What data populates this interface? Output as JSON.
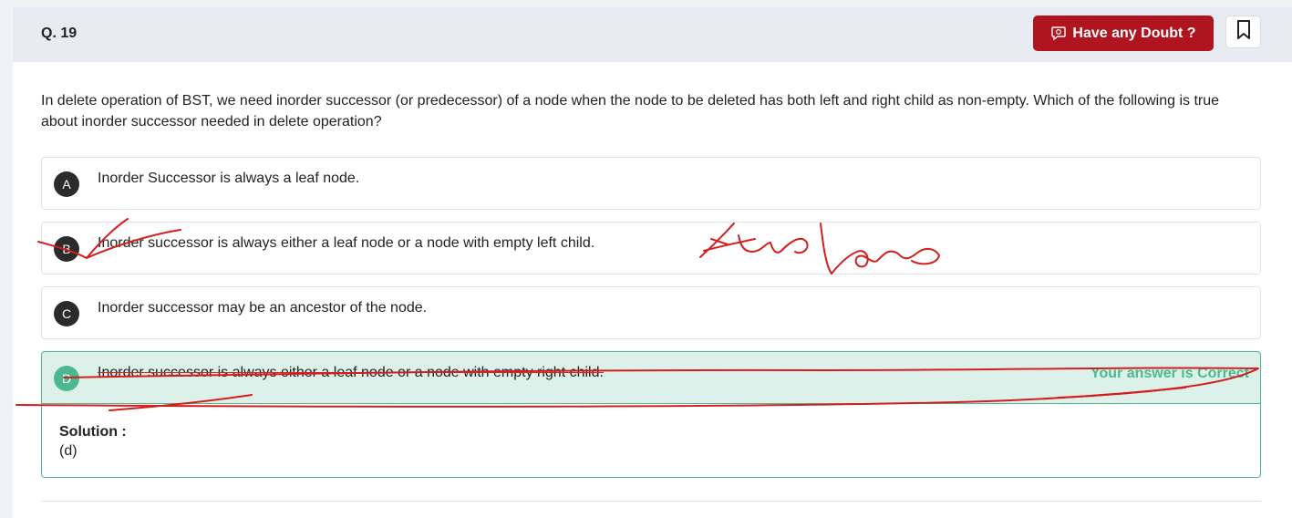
{
  "question": {
    "number": "Q. 19",
    "text": "In delete operation of BST, we need inorder successor (or predecessor) of a node when the node to be deleted has both left and right child as non-empty. Which of the following is true about inorder successor needed in delete operation?"
  },
  "header": {
    "doubt_label": "Have any Doubt ?"
  },
  "options": [
    {
      "letter": "A",
      "text": "Inorder Successor is always a leaf node."
    },
    {
      "letter": "B",
      "text": "Inorder successor is always either a leaf node or a node with empty left child."
    },
    {
      "letter": "C",
      "text": "Inorder successor may be an ancestor of the node."
    },
    {
      "letter": "D",
      "text": "Inorder successor is always either a leaf node or a node with empty right child."
    }
  ],
  "result": {
    "label": "Your answer is Correct"
  },
  "solution": {
    "title": "Solution :",
    "body": "(d)"
  },
  "colors": {
    "accent_button": "#b0151f",
    "correct_green": "#4cb890",
    "correct_bg": "#dcf1ea",
    "annotation_red": "#d41e1e"
  }
}
